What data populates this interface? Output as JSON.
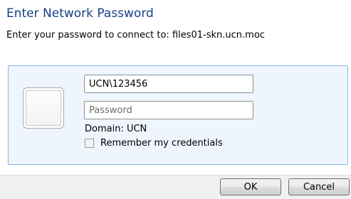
{
  "dialog": {
    "title": "Enter Network Password",
    "subtitle": "Enter your password to connect to: files01-skn.ucn.moc"
  },
  "credentials": {
    "username_value": "UCN\\123456",
    "password_placeholder": "Password",
    "domain_text": "Domain: UCN",
    "remember_label": "Remember my credentials",
    "remember_checked": false
  },
  "buttons": {
    "ok_label": "OK",
    "cancel_label": "Cancel"
  },
  "colors": {
    "title": "#1a3f85",
    "tile_background": "#eef5fd",
    "tile_border": "#83b8e8"
  },
  "icons": [
    "user-picture-icon"
  ]
}
